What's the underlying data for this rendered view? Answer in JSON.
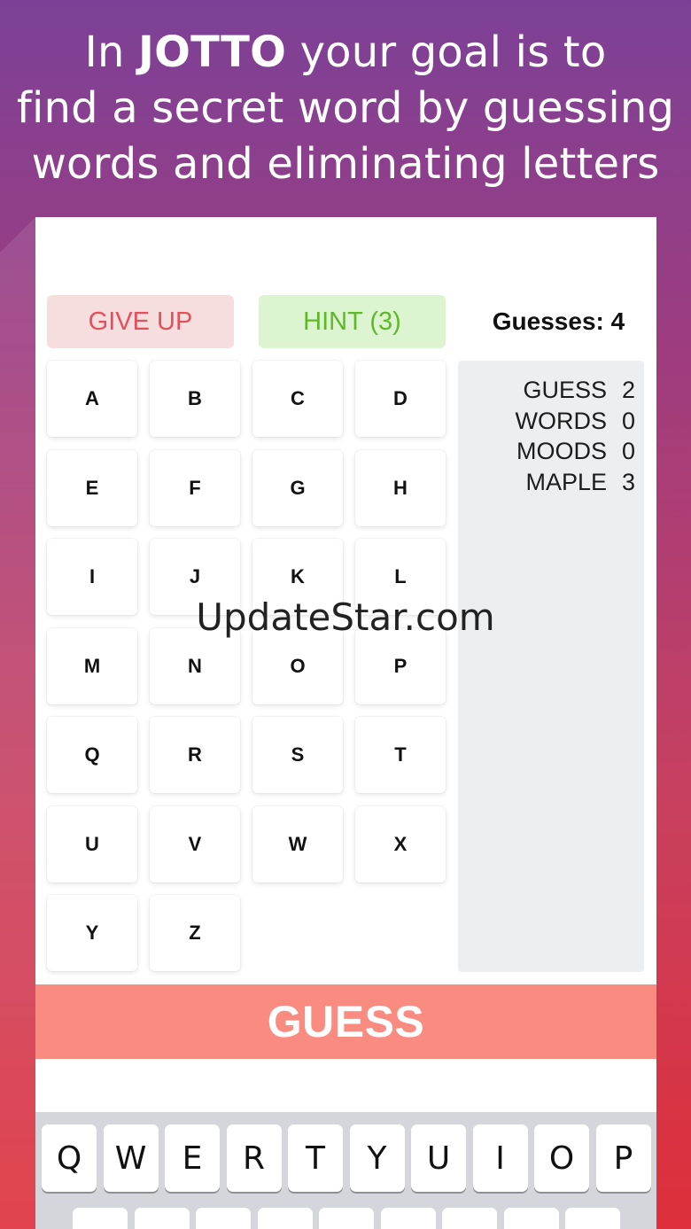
{
  "headline": {
    "line1_pre": "In ",
    "line1_brand": "JOTTO",
    "line1_post": " your goal is to",
    "line2": "find a secret word by guessing",
    "line3": "words and eliminating letters"
  },
  "controls": {
    "give_up": "GIVE UP",
    "hint": "HINT (3)",
    "guesses": "Guesses: 4"
  },
  "letters": [
    "A",
    "B",
    "C",
    "D",
    "E",
    "F",
    "G",
    "H",
    "I",
    "J",
    "K",
    "L",
    "M",
    "N",
    "O",
    "P",
    "Q",
    "R",
    "S",
    "T",
    "U",
    "V",
    "W",
    "X",
    "Y",
    "Z"
  ],
  "history": [
    {
      "word": "GUESS",
      "count": "2"
    },
    {
      "word": "WORDS",
      "count": "0"
    },
    {
      "word": "MOODS",
      "count": "0"
    },
    {
      "word": "MAPLE",
      "count": "3"
    }
  ],
  "guess_button": "GUESS",
  "keyboard": {
    "row1": [
      "Q",
      "W",
      "E",
      "R",
      "T",
      "Y",
      "U",
      "I",
      "O",
      "P"
    ]
  },
  "watermark": "UpdateStar.com",
  "colors": {
    "give_up_text": "#e2505c",
    "hint_text": "#5eb82a",
    "guess_bar": "#fa8b80"
  }
}
